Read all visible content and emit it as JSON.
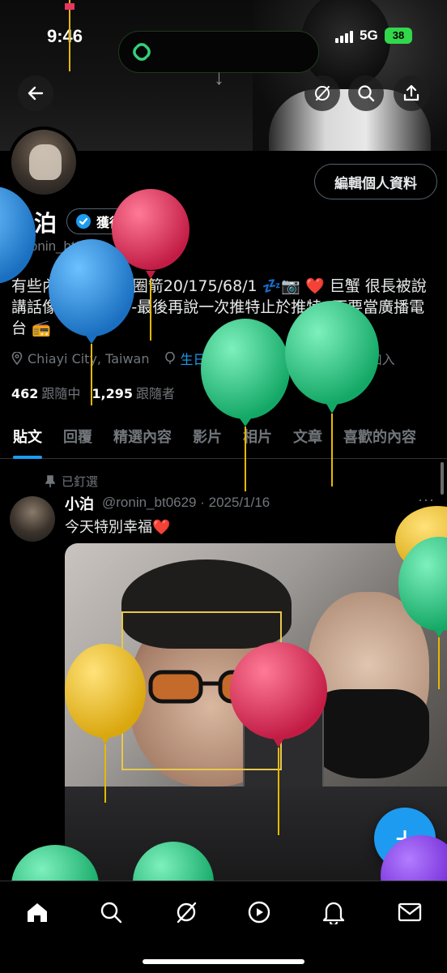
{
  "status_bar": {
    "time": "9:46",
    "network": "5G",
    "battery": "38"
  },
  "header": {
    "back_icon": "arrow-left-icon",
    "actions": [
      "grok-icon",
      "search-icon",
      "share-icon"
    ]
  },
  "profile": {
    "name": "小泊",
    "verified_label": "獲得認證",
    "handle": "@ronin_bt0629",
    "edit_button": "編輯個人資料",
    "bio": "有些內容未滿 🔞 圈箭20/175/68/1 💤📷 ❤️ 巨蟹 很長被說講話像+9 喜 🐭 /-最後再說一次推特止於推特- 不要當廣播電台 📻",
    "location": "Chiayi City, Taiwan",
    "birthday": "生日快樂！",
    "joined": "於 2019年12月加入",
    "following_count": "462",
    "following_label": "跟隨中",
    "followers_count": "1,295",
    "followers_label": "跟隨者"
  },
  "tabs": [
    "貼文",
    "回覆",
    "精選內容",
    "影片",
    "相片",
    "文章",
    "喜歡的內容"
  ],
  "active_tab": "貼文",
  "post": {
    "pinned_label": "已釘選",
    "author": "小泊",
    "handle_date": "@ronin_bt0629 · 2025/1/16",
    "more": "···",
    "text": "今天特別幸福❤️"
  },
  "fab": {
    "label": "+",
    "icon": "compose-plus-icon"
  },
  "bottom_nav": [
    "home-icon",
    "search-icon",
    "grok-icon",
    "video-icon",
    "bell-icon",
    "mail-icon"
  ],
  "colors": {
    "accent": "#1d9bf0",
    "background": "#000000",
    "muted": "#71767b",
    "battery": "#32d74b"
  },
  "balloon_colors": [
    "#2f8fe0",
    "#e8365f",
    "#2dd48a",
    "#f2c72e",
    "#8b3ff0"
  ]
}
